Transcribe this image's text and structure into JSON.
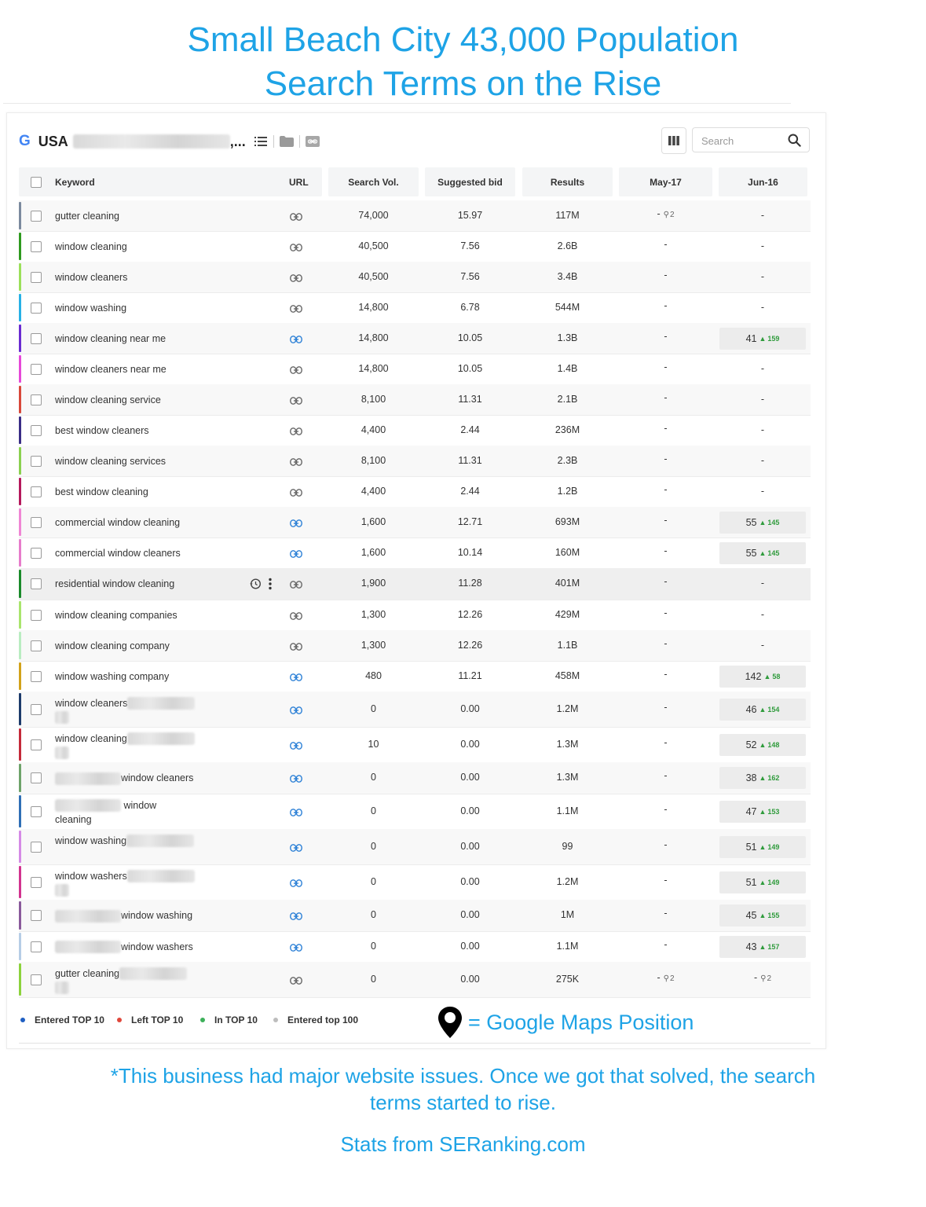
{
  "headline": {
    "line1": "Small Beach City 43,000 Population",
    "line2": "Search Terms on the Rise"
  },
  "toolbar": {
    "engine_logo": "G",
    "region": "USA",
    "region_suffix": ",...",
    "search_placeholder": "Search"
  },
  "columns": {
    "keyword": "Keyword",
    "url": "URL",
    "search_vol": "Search Vol.",
    "suggested_bid": "Suggested bid",
    "results": "Results",
    "may": "May-17",
    "jun": "Jun-16"
  },
  "rows": [
    {
      "kw": "gutter cleaning",
      "vol": "74,000",
      "bid": "15.97",
      "res": "117M",
      "may": "-",
      "may_pin": "2",
      "jun": "-",
      "color": "#7b8a9e"
    },
    {
      "kw": "window cleaning",
      "vol": "40,500",
      "bid": "7.56",
      "res": "2.6B",
      "may": "-",
      "jun": "-",
      "color": "#2e9a1f"
    },
    {
      "kw": "window cleaners",
      "vol": "40,500",
      "bid": "7.56",
      "res": "3.4B",
      "may": "-",
      "jun": "-",
      "color": "#9be05a"
    },
    {
      "kw": "window washing",
      "vol": "14,800",
      "bid": "6.78",
      "res": "544M",
      "may": "-",
      "jun": "-",
      "color": "#27b1e6"
    },
    {
      "kw": "window cleaning near me",
      "vol": "14,800",
      "bid": "10.05",
      "res": "1.3B",
      "may": "-",
      "jun": "41",
      "jun_ch": "159",
      "color": "#6a2bd1"
    },
    {
      "kw": "window cleaners near me",
      "vol": "14,800",
      "bid": "10.05",
      "res": "1.4B",
      "may": "-",
      "jun": "-",
      "color": "#e649d8"
    },
    {
      "kw": "window cleaning service",
      "vol": "8,100",
      "bid": "11.31",
      "res": "2.1B",
      "may": "-",
      "jun": "-",
      "color": "#d8483a"
    },
    {
      "kw": "best window cleaners",
      "vol": "4,400",
      "bid": "2.44",
      "res": "236M",
      "may": "-",
      "jun": "-",
      "color": "#3a2d86"
    },
    {
      "kw": "window cleaning services",
      "vol": "8,100",
      "bid": "11.31",
      "res": "2.3B",
      "may": "-",
      "jun": "-",
      "color": "#8ad04f"
    },
    {
      "kw": "best window cleaning",
      "vol": "4,400",
      "bid": "2.44",
      "res": "1.2B",
      "may": "-",
      "jun": "-",
      "color": "#b5195c"
    },
    {
      "kw": "commercial window cleaning",
      "vol": "1,600",
      "bid": "12.71",
      "res": "693M",
      "may": "-",
      "jun": "55",
      "jun_ch": "145",
      "color": "#ef86d4"
    },
    {
      "kw": "commercial window cleaners",
      "vol": "1,600",
      "bid": "10.14",
      "res": "160M",
      "may": "-",
      "jun": "55",
      "jun_ch": "145",
      "color": "#e77ccb"
    },
    {
      "kw": "residential window cleaning",
      "vol": "1,900",
      "bid": "11.28",
      "res": "401M",
      "may": "-",
      "jun": "-",
      "color": "#1a8a2a",
      "hover": true
    },
    {
      "kw": "window cleaning companies",
      "vol": "1,300",
      "bid": "12.26",
      "res": "429M",
      "may": "-",
      "jun": "-",
      "color": "#a9e56d"
    },
    {
      "kw": "window cleaning company",
      "vol": "1,300",
      "bid": "12.26",
      "res": "1.1B",
      "may": "-",
      "jun": "-",
      "color": "#b9ecc1"
    },
    {
      "kw": "window washing company",
      "vol": "480",
      "bid": "11.21",
      "res": "458M",
      "may": "-",
      "jun": "142",
      "jun_ch": "58",
      "color": "#d2a21a"
    },
    {
      "kw": "window cleaners",
      "vol": "0",
      "bid": "0.00",
      "res": "1.2M",
      "may": "-",
      "jun": "46",
      "jun_ch": "154",
      "color": "#1d3b6b",
      "blur": "after2"
    },
    {
      "kw": "window cleaning",
      "vol": "10",
      "bid": "0.00",
      "res": "1.3M",
      "may": "-",
      "jun": "52",
      "jun_ch": "148",
      "color": "#c42a3a",
      "blur": "after2"
    },
    {
      "kw": "window cleaners",
      "vol": "0",
      "bid": "0.00",
      "res": "1.3M",
      "may": "-",
      "jun": "38",
      "jun_ch": "162",
      "color": "#6ea36a",
      "blur": "before"
    },
    {
      "kw": "window",
      "kw2": "cleaning",
      "vol": "0",
      "bid": "0.00",
      "res": "1.1M",
      "may": "-",
      "jun": "47",
      "jun_ch": "153",
      "color": "#2f6fb6",
      "blur": "before2"
    },
    {
      "kw": "window washing",
      "vol": "0",
      "bid": "0.00",
      "res": "99",
      "may": "-",
      "jun": "51",
      "jun_ch": "149",
      "color": "#d58ae6",
      "blur": "after"
    },
    {
      "kw": "window washers",
      "vol": "0",
      "bid": "0.00",
      "res": "1.2M",
      "may": "-",
      "jun": "51",
      "jun_ch": "149",
      "color": "#d2338f",
      "blur": "after2"
    },
    {
      "kw": "window washing",
      "vol": "0",
      "bid": "0.00",
      "res": "1M",
      "may": "-",
      "jun": "45",
      "jun_ch": "155",
      "color": "#8a5a9b",
      "blur": "before"
    },
    {
      "kw": "window washers",
      "vol": "0",
      "bid": "0.00",
      "res": "1.1M",
      "may": "-",
      "jun": "43",
      "jun_ch": "157",
      "color": "#b6cde6",
      "blur": "before"
    },
    {
      "kw": "gutter cleaning",
      "vol": "0",
      "bid": "0.00",
      "res": "275K",
      "may": "-",
      "may_pin": "2",
      "jun": "-",
      "jun_pin": "2",
      "color": "#8cd23c",
      "blur": "after2"
    }
  ],
  "legend": [
    {
      "label": "Entered TOP 10",
      "color": "#1f5fc2"
    },
    {
      "label": "Left TOP 10",
      "color": "#e0473b"
    },
    {
      "label": "In TOP 10",
      "color": "#3db05a"
    },
    {
      "label": "Entered top 100",
      "color": "#bdbdbd"
    }
  ],
  "maps_note": "= Google Maps Position",
  "footer": {
    "line1": "*This business had major website issues.  Once we got that solved, the search",
    "line2": "terms started to rise.",
    "credit": "Stats from SERanking.com"
  },
  "colors": {
    "accent": "#1ea3e6",
    "link_active": "#2a7fd6",
    "link_inactive": "#666666",
    "growth": "#2f9b3c"
  }
}
